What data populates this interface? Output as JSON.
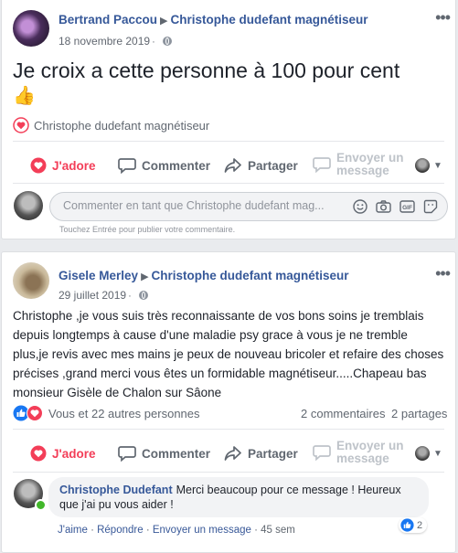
{
  "post1": {
    "author": "Bertrand Paccou",
    "page": "Christophe dudefant magnétiseur",
    "date": "18 novembre 2019",
    "text": "Je croix a cette personne à 100 pour cent",
    "emoji": "👍",
    "reactions_label": "Christophe dudefant magnétiseur",
    "actions": {
      "like": "J'adore",
      "comment": "Commenter",
      "share": "Partager",
      "send": "Envoyer un message"
    },
    "comment_placeholder": "Commenter en tant que Christophe dudefant mag...",
    "enter_hint": "Touchez Entrée pour publier votre commentaire."
  },
  "post2": {
    "author": "Gisele Merley",
    "page": "Christophe dudefant magnétiseur",
    "date": "29 juillet 2019",
    "text": "Christophe ,je vous suis très reconnaissante de vos bons soins je tremblais depuis longtemps à cause d'une maladie psy grace à vous je ne tremble plus,je revis avec mes mains je peux de nouveau bricoler et refaire des choses précises ,grand merci vous êtes un formidable magnétiseur.....Chapeau bas monsieur Gisèle de Chalon sur Sâone",
    "reactions_label": "Vous et 22 autres personnes",
    "comments_count": "2 commentaires",
    "shares_count": "2 partages",
    "actions": {
      "like": "J'adore",
      "comment": "Commenter",
      "share": "Partager",
      "send": "Envoyer un message"
    },
    "reply": {
      "author": "Christophe Dudefant",
      "text": "Merci beaucoup pour ce message ! Heureux que j'ai pu vous aider !",
      "like": "J'aime",
      "respond": "Répondre",
      "send": "Envoyer un message",
      "time": "45 sem",
      "like_count": "2"
    }
  },
  "colors": {
    "link": "#365899",
    "love": "#f33e58",
    "like_blue": "#1877f2",
    "muted": "#606770"
  }
}
